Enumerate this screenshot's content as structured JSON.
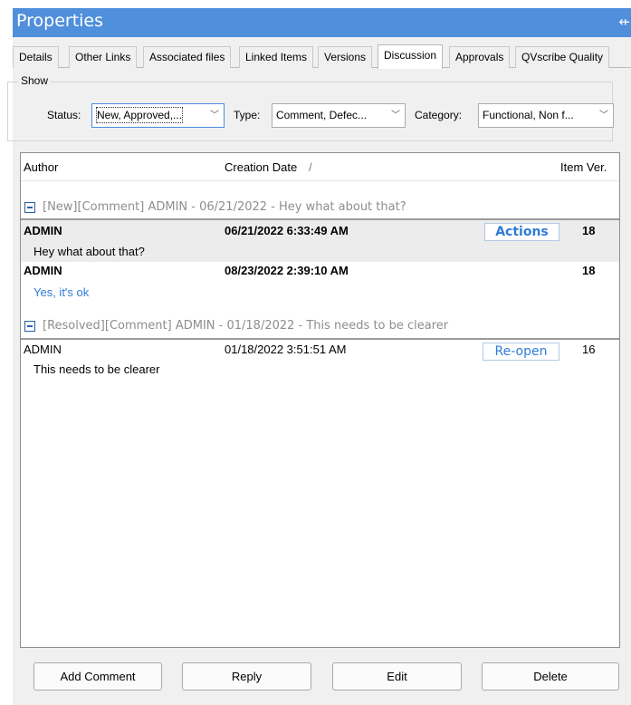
{
  "window": {
    "title": "Properties",
    "pin_icon": "pin-icon"
  },
  "tabs": [
    {
      "label": "Details"
    },
    {
      "label": "Other Links"
    },
    {
      "label": "Associated files"
    },
    {
      "label": "Linked Items"
    },
    {
      "label": "Versions"
    },
    {
      "label": "Discussion",
      "active": true
    },
    {
      "label": "Approvals"
    },
    {
      "label": "QVscribe Quality"
    }
  ],
  "filters": {
    "group_label": "Show",
    "status": {
      "label": "Status:",
      "value": "New, Approved,..."
    },
    "type": {
      "label": "Type:",
      "value": "Comment, Defec..."
    },
    "category": {
      "label": "Category:",
      "value": "Functional, Non f..."
    }
  },
  "grid": {
    "columns": {
      "author": "Author",
      "creation_date": "Creation Date",
      "sort_marker": "/",
      "item_ver": "Item Ver."
    },
    "groups": [
      {
        "header": "[New][Comment] ADMIN  -  06/21/2022  -  Hey what about that?",
        "items": [
          {
            "author": "ADMIN",
            "date": "06/21/2022 6:33:49 AM",
            "action": "Actions",
            "version": "18",
            "comment": "Hey what about that?"
          },
          {
            "author": "ADMIN",
            "date": "08/23/2022 2:39:10 AM",
            "version": "18",
            "comment": "Yes, it's ok"
          }
        ]
      },
      {
        "header": "[Resolved][Comment] ADMIN  -  01/18/2022  -  This needs to be clearer",
        "items": [
          {
            "author": "ADMIN",
            "date": "01/18/2022 3:51:51 AM",
            "action": "Re-open",
            "version": "16",
            "comment": "This needs to be clearer"
          }
        ]
      }
    ]
  },
  "buttons": {
    "add_comment": "Add Comment",
    "reply": "Reply",
    "edit": "Edit",
    "delete": "Delete"
  },
  "colors": {
    "titlebar": "#4f8fdc",
    "link_blue": "#2f7bd8",
    "group_gray": "#8e8e8e"
  }
}
